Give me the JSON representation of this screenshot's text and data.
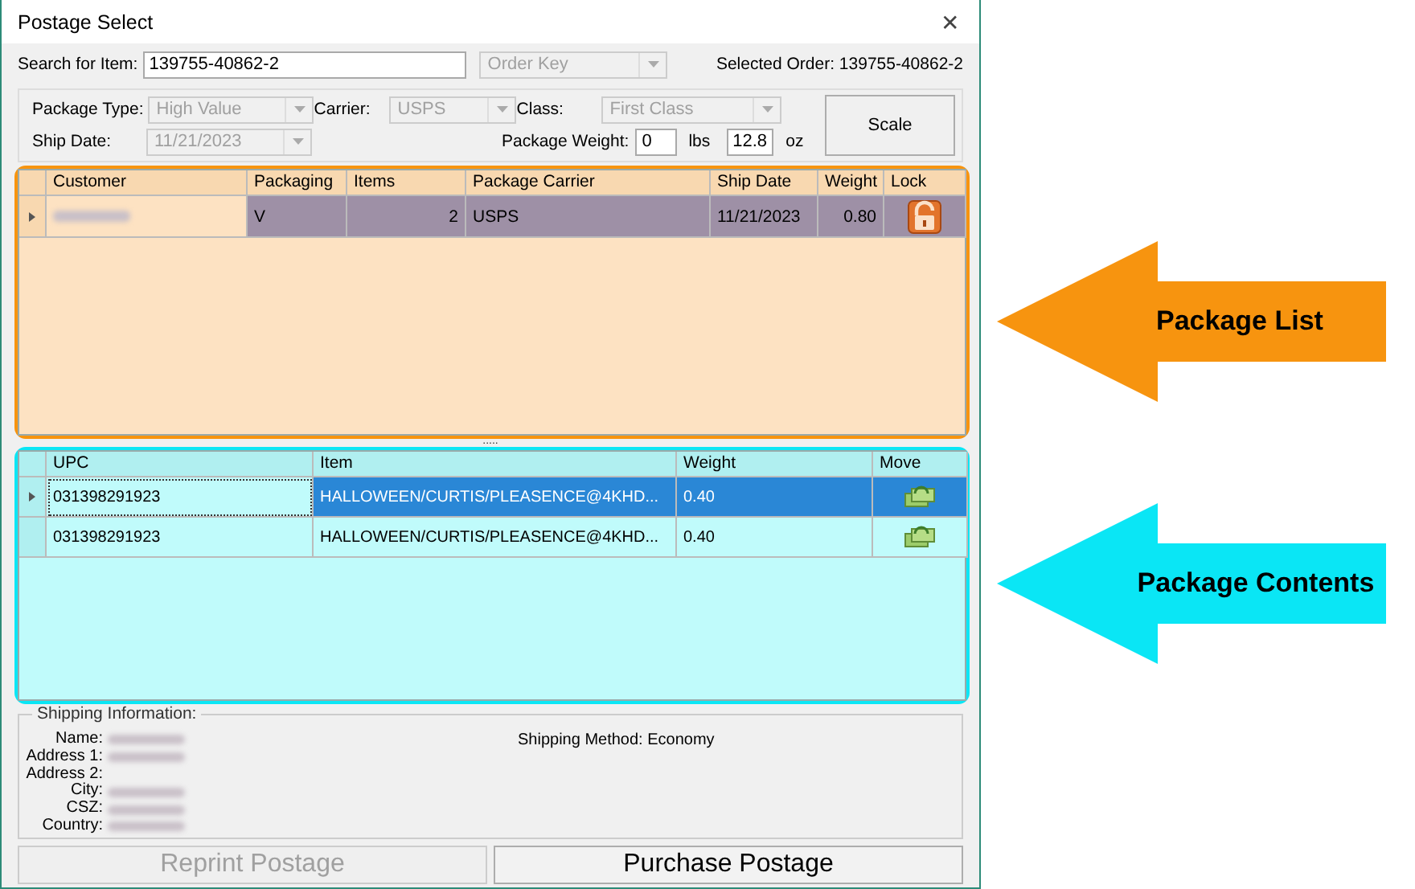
{
  "window": {
    "title": "Postage Select",
    "close": "✕"
  },
  "search": {
    "label": "Search for Item:",
    "value": "139755-40862-2",
    "key_field": {
      "value": "Order Key",
      "disabled": true
    },
    "selected_order": "Selected Order: 139755-40862-2"
  },
  "options": {
    "fields": [
      {
        "label": "Package Type:",
        "value": "High Value",
        "disabled": true
      },
      {
        "label": "Carrier:",
        "value": "USPS",
        "disabled": true
      },
      {
        "label": "Class:",
        "value": "First Class",
        "disabled": true
      },
      {
        "label": "Ship Date:",
        "value": "11/21/2023",
        "disabled": true
      }
    ],
    "weight": {
      "label": "Package Weight:",
      "lbs": "0",
      "lbs_unit": "lbs",
      "oz": "12.8",
      "oz_unit": "oz"
    },
    "scale_button": "Scale"
  },
  "package_list": {
    "columns": [
      {
        "label": "Customer",
        "kind": "redacted"
      },
      {
        "label": "Packaging",
        "kind": "text"
      },
      {
        "label": "Items",
        "kind": "number"
      },
      {
        "label": "Package Carrier",
        "kind": "text"
      },
      {
        "label": "Ship Date",
        "kind": "text"
      },
      {
        "label": "Weight",
        "kind": "number"
      },
      {
        "label": "Lock",
        "kind": "lock"
      }
    ],
    "rows": [
      {
        "selected": true,
        "current": true,
        "cells": [
          "",
          "V",
          "2",
          "USPS",
          "11/21/2023",
          "0.80",
          ""
        ]
      }
    ]
  },
  "splitter": ".....",
  "package_contents": {
    "columns": [
      {
        "label": "UPC",
        "kind": "text"
      },
      {
        "label": "Item",
        "kind": "text"
      },
      {
        "label": "Weight",
        "kind": "text"
      },
      {
        "label": "Move",
        "kind": "move"
      }
    ],
    "rows": [
      {
        "selected": true,
        "current": true,
        "cells": [
          "031398291923",
          "HALLOWEEN/CURTIS/PLEASENCE@4KHD...",
          "0.40",
          ""
        ]
      },
      {
        "selected": false,
        "current": false,
        "cells": [
          "031398291923",
          "HALLOWEEN/CURTIS/PLEASENCE@4KHD...",
          "0.40",
          ""
        ]
      }
    ]
  },
  "shipping_information": {
    "title": "Shipping Information:",
    "fields": [
      {
        "label": "Name:",
        "redacted": true
      },
      {
        "label": "Address 1:",
        "redacted": true
      },
      {
        "label": "Address 2:",
        "redacted": false
      },
      {
        "label": "City:",
        "redacted": true
      },
      {
        "label": "CSZ:",
        "redacted": true
      },
      {
        "label": "Country:",
        "redacted": true
      }
    ],
    "shipping_method": "Shipping Method: Economy"
  },
  "buttons": [
    {
      "label": "Reprint Postage",
      "disabled": true
    },
    {
      "label": "Purchase Postage",
      "disabled": false
    }
  ],
  "callouts": [
    {
      "text": "Package List",
      "color": "#f7940f"
    },
    {
      "text": "Package Contents",
      "color": "#0ae6f5"
    }
  ]
}
